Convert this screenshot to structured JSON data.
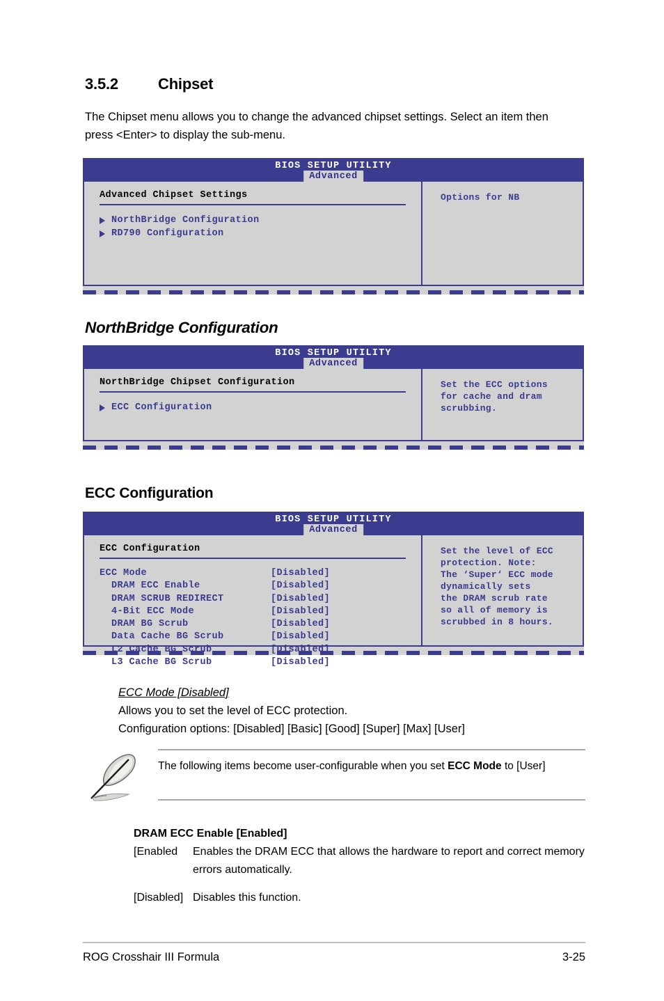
{
  "section": {
    "number": "3.5.2",
    "title": "Chipset",
    "intro": "The Chipset menu allows you to change the advanced chipset settings. Select an item then press <Enter> to display the sub-menu."
  },
  "bios_common": {
    "title": "BIOS SETUP UTILITY",
    "tab": "Advanced"
  },
  "screen1": {
    "panel_title": "Advanced Chipset Settings",
    "menu": [
      {
        "label": "NorthBridge Configuration"
      },
      {
        "label": "RD790 Configuration"
      }
    ],
    "help": "Options for NB"
  },
  "screen2": {
    "heading": "NorthBridge Configuration",
    "panel_title": "NorthBridge Chipset Configuration",
    "menu": [
      {
        "label": "ECC Configuration"
      }
    ],
    "help": "Set the ECC options\nfor cache and dram\nscrubbing."
  },
  "screen3": {
    "heading": "ECC Configuration",
    "panel_title": "ECC Configuration",
    "help": "Set the level of ECC\nprotection. Note:\nThe ‘Super‘ ECC mode\ndynamically sets\nthe DRAM scrub rate\nso all of memory is\nscrubbed in 8 hours.",
    "rows": [
      {
        "label": "ECC Mode",
        "value": "[Disabled]"
      },
      {
        "label": "  DRAM ECC Enable",
        "value": "[Disabled]"
      },
      {
        "label": "  DRAM SCRUB REDIRECT",
        "value": "[Disabled]"
      },
      {
        "label": "  4-Bit ECC Mode",
        "value": "[Disabled]"
      },
      {
        "label": "  DRAM BG Scrub",
        "value": "[Disabled]"
      },
      {
        "label": "  Data Cache BG Scrub",
        "value": "[Disabled]"
      },
      {
        "label": "  L2 Cache BG Scrub",
        "value": "[Disabled]"
      },
      {
        "label": "  L3 Cache BG Scrub",
        "value": "[Disabled]"
      }
    ]
  },
  "ecc_mode_desc": {
    "title": "ECC Mode [Disabled]",
    "line1": "Allows you to set the level of ECC protection.",
    "line2": "Configuration options: [Disabled] [Basic] [Good] [Super] [Max] [User]"
  },
  "note": {
    "text_before": "The following items become user-configurable when you set ",
    "bold": "ECC Mode",
    "text_after": " to [User]"
  },
  "dram_ecc": {
    "title": "DRAM ECC Enable [Enabled]",
    "enabled_key": "[Enabled",
    "enabled_val": "Enables the DRAM ECC that allows the hardware to report and correct memory errors automatically.",
    "disabled_key": "[Disabled]",
    "disabled_val": "Disables this function."
  },
  "footer": {
    "left": "ROG Crosshair III Formula",
    "right": "3-25"
  },
  "colors": {
    "bios_header": "#3b3b8f",
    "bios_panel": "#d2d2d2",
    "bios_text": "#3b3b8f"
  }
}
